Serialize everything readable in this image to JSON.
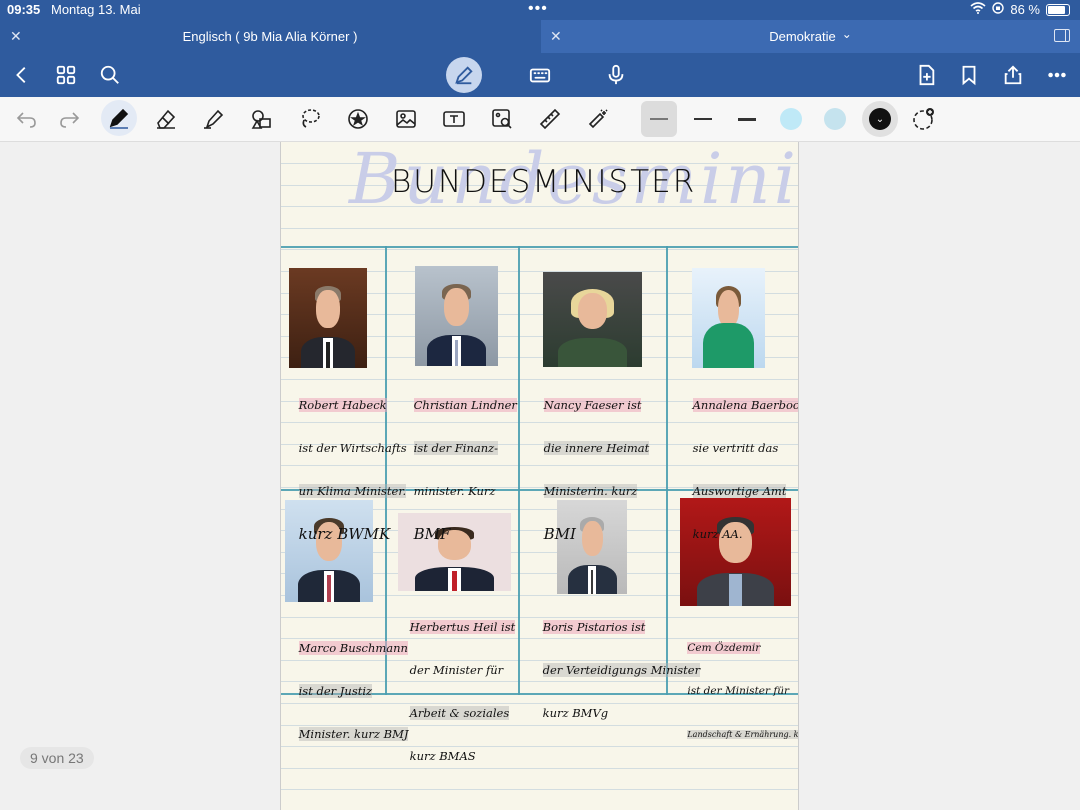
{
  "status": {
    "time": "09:35",
    "date": "Montag 13. Mai",
    "battery": "86 %"
  },
  "tabs": [
    {
      "label": "Englisch ( 9b Mia Alia Körner )",
      "active": false
    },
    {
      "label": "Demokratie",
      "active": true,
      "chevron": "⌄"
    }
  ],
  "nav": {
    "icons": [
      "back-icon",
      "grid-icon",
      "search-icon",
      "pen-mode-icon",
      "keyboard-icon",
      "mic-icon",
      "add-page-icon",
      "bookmark-icon",
      "share-icon",
      "more-icon"
    ]
  },
  "toolbar": {
    "tools": [
      "undo-icon",
      "redo-icon",
      "pen-icon",
      "eraser-icon",
      "highlighter-icon",
      "shapes-icon",
      "lasso-icon",
      "sticker-icon",
      "image-icon",
      "textbox-icon",
      "image-search-icon",
      "ruler-icon",
      "laser-pointer-icon"
    ],
    "colors": [
      "#bfe9f7",
      "#c5e3ee",
      "#111111"
    ]
  },
  "page": {
    "heading": "BUNDESMINISTER",
    "heading_ghost": "Bundesminister",
    "counter": "9 von 23"
  },
  "ministers": [
    {
      "line1": "Robert Habeck",
      "line2": "ist der Wirtschafts",
      "line3": "un Klima Minister.",
      "line4": "kurz BWMK"
    },
    {
      "line1": "Christian Lindner",
      "line2": "ist der Finanz-",
      "line3": "minister. Kurz",
      "line4": "BMF"
    },
    {
      "line1": "Nancy Faeser ist",
      "line2": "die innere Heimat",
      "line3": "Ministerin. kurz",
      "line4": "BMI"
    },
    {
      "line1": "Annalena Baerbock",
      "line2": "sie vertritt das",
      "line3": "Auswortige Amt",
      "line4": "kurz AA."
    },
    {
      "line1": "Marco Buschmann",
      "line2": "ist der Justiz",
      "line3": "Minister. kurz BMJ",
      "line4": ""
    },
    {
      "line1": "Herbertus Heil ist",
      "line2": "der Minister für",
      "line3": "Arbeit & soziales",
      "line4": "kurz BMAS"
    },
    {
      "line1": "Boris Pistarios ist",
      "line2": "der Verteidigungs Minister",
      "line3": "kurz BMVg",
      "line4": ""
    },
    {
      "line1": "Cem Özdemir",
      "line2": "ist der Minister für",
      "line3": "Landschaft & Ernährung. kurz BMEL",
      "line4": ""
    }
  ]
}
